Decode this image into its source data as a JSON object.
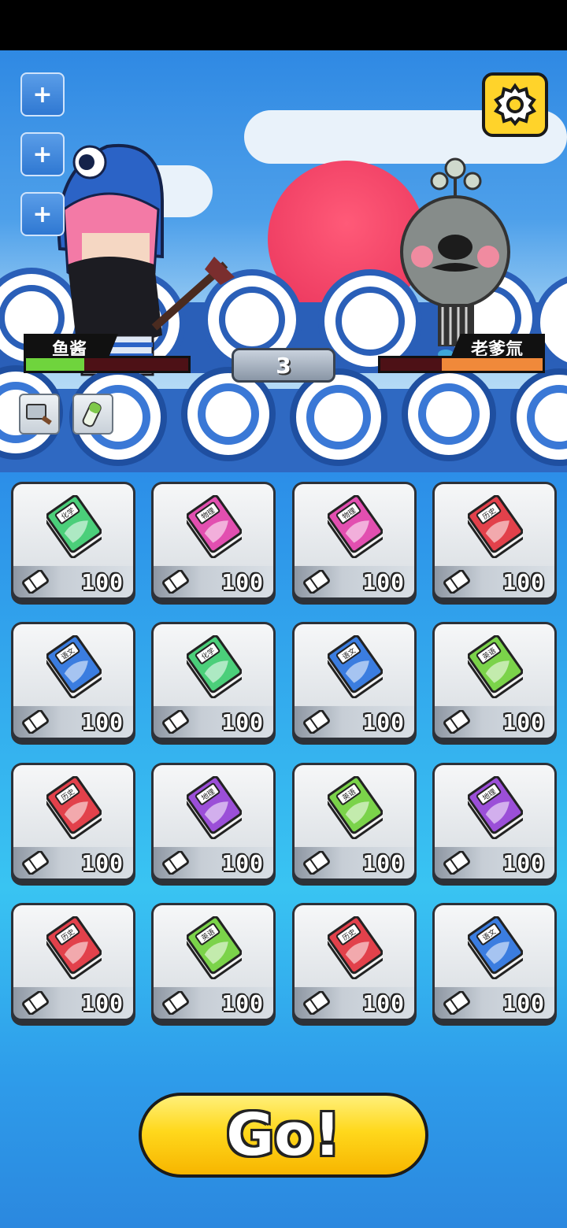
{
  "battle": {
    "player": {
      "name": "鱼酱",
      "hp_fraction": 0.36,
      "hp_color": "#6fd43d"
    },
    "enemy": {
      "name": "老爹氚",
      "hp_fraction": 0.62,
      "hp_color": "#f0893a"
    },
    "turn": "3"
  },
  "left_buttons": [
    {
      "icon": "plus-icon"
    },
    {
      "icon": "plus-icon"
    },
    {
      "icon": "plus-icon"
    }
  ],
  "items": [
    {
      "icon": "cleaver-icon"
    },
    {
      "icon": "scallion-icon"
    }
  ],
  "subject_colors": {
    "化学": "#4bcf7a",
    "物理": "#e24fb0",
    "历史": "#e2414b",
    "语文": "#3b7de0",
    "英语": "#7bd34a",
    "地理": "#9b4fd8"
  },
  "cards": [
    {
      "subject": "化学",
      "cost": "100"
    },
    {
      "subject": "物理",
      "cost": "100"
    },
    {
      "subject": "物理",
      "cost": "100"
    },
    {
      "subject": "历史",
      "cost": "100"
    },
    {
      "subject": "语文",
      "cost": "100"
    },
    {
      "subject": "化学",
      "cost": "100"
    },
    {
      "subject": "语文",
      "cost": "100"
    },
    {
      "subject": "英语",
      "cost": "100"
    },
    {
      "subject": "历史",
      "cost": "100"
    },
    {
      "subject": "地理",
      "cost": "100"
    },
    {
      "subject": "英语",
      "cost": "100"
    },
    {
      "subject": "地理",
      "cost": "100"
    },
    {
      "subject": "历史",
      "cost": "100"
    },
    {
      "subject": "英语",
      "cost": "100"
    },
    {
      "subject": "历史",
      "cost": "100"
    },
    {
      "subject": "语文",
      "cost": "100"
    }
  ],
  "go_button": {
    "label": "Go!"
  }
}
